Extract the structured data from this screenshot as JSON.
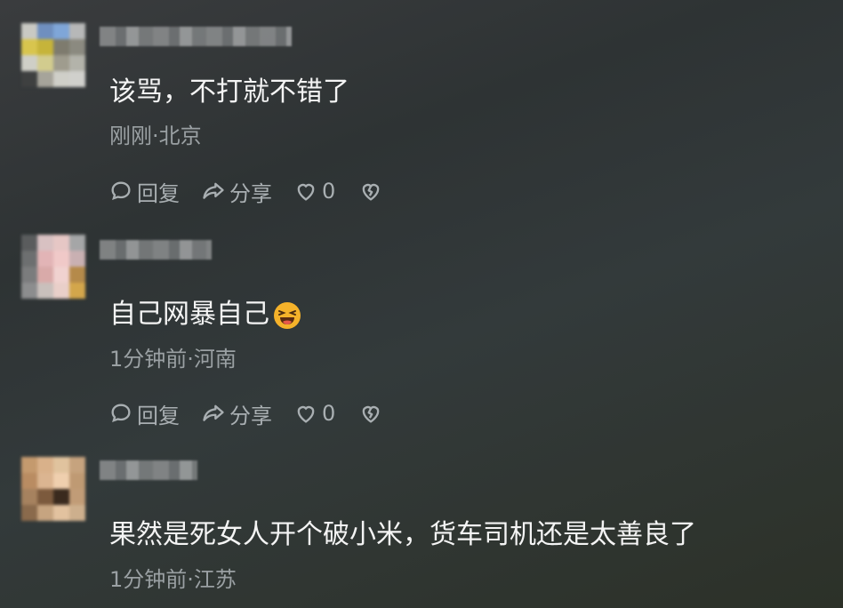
{
  "comments": [
    {
      "text": "该骂，不打就不错了",
      "meta": "刚刚·北京",
      "reply_label": "回复",
      "share_label": "分享",
      "like_count": "0",
      "avatar_colors": [
        "#c9c9c3",
        "#6f8fbf",
        "#7fa6d8",
        "#b7b8b8",
        "#d8c54e",
        "#c6b43a",
        "#7e7b6e",
        "#8b8a80",
        "#cfcfc7",
        "#d2cc8e",
        "#9f9c8e",
        "#b3b3aa",
        "#3e4040",
        "#a6a49a",
        "#cfcfc8",
        "#d0d0cc"
      ]
    },
    {
      "text": "自己网暴自己",
      "meta": "1分钟前·河南",
      "reply_label": "回复",
      "share_label": "分享",
      "like_count": "0",
      "avatar_colors": [
        "#5a5c5d",
        "#d8c1c2",
        "#e6c7c5",
        "#a5a6a7",
        "#6d6f70",
        "#e2b4b6",
        "#f0c9c8",
        "#c9b0b2",
        "#7b7c7d",
        "#d9aaa9",
        "#f0d2d0",
        "#b58a4a",
        "#8c8d8e",
        "#c9c0bc",
        "#e9cfc9",
        "#d3a64b"
      ]
    },
    {
      "text": "果然是死女人开个破小米，货车司机还是太善良了",
      "meta": "1分钟前·江苏",
      "avatar_colors": [
        "#c49a6e",
        "#d9b18a",
        "#e0c39e",
        "#c6a37e",
        "#b98c62",
        "#dbb591",
        "#efcfae",
        "#bf9a73",
        "#a6825f",
        "#7c5a3d",
        "#3a2a1e",
        "#c19c77",
        "#8a6a4c",
        "#c6a480",
        "#e2c29f",
        "#cdaf8d"
      ]
    }
  ],
  "colors": {
    "text": "#f4f4f4",
    "meta": "#9aa0a3",
    "emoji": "#f5b22a"
  }
}
